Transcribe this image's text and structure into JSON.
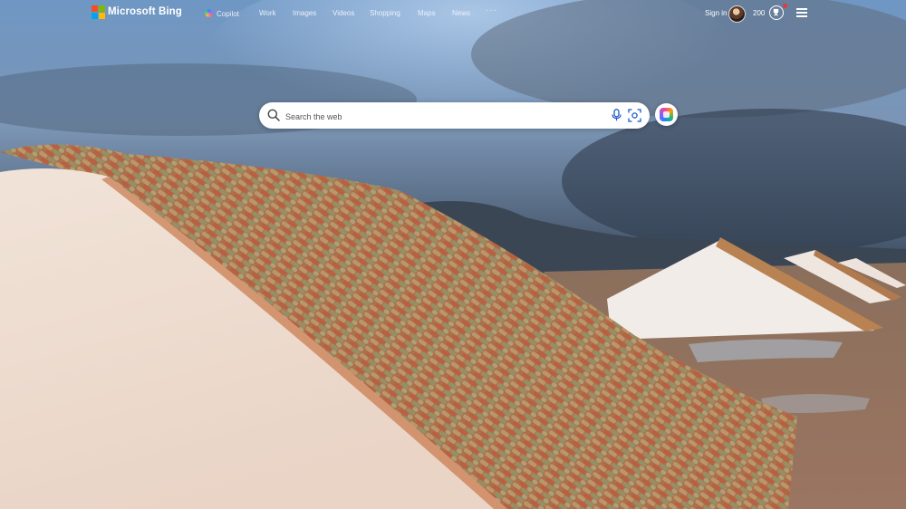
{
  "brand": {
    "name": "Microsoft Bing",
    "colors": [
      "#f25022",
      "#7fba00",
      "#00a4ef",
      "#ffb900"
    ]
  },
  "nav": {
    "items": [
      {
        "label": "Copilot",
        "icon": "copilot-icon"
      },
      {
        "label": "Work"
      },
      {
        "label": "Images"
      },
      {
        "label": "Videos"
      },
      {
        "label": "Shopping"
      },
      {
        "label": "Maps"
      },
      {
        "label": "News"
      }
    ],
    "more_label": "···"
  },
  "account": {
    "signin_label": "Sign in",
    "points": "200"
  },
  "search": {
    "placeholder": "Search the web",
    "value": ""
  },
  "icons": {
    "search": "search-icon",
    "mic": "microphone-icon",
    "visual_search": "visual-search-icon",
    "copilot": "copilot-icon",
    "rewards": "trophy-icon",
    "menu": "hamburger-menu-icon"
  }
}
